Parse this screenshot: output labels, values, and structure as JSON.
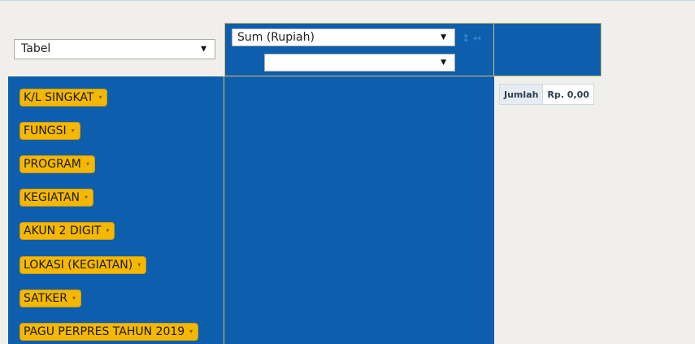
{
  "renderer": {
    "selected": "Tabel",
    "caret_icon": "triangle-down"
  },
  "aggregator": {
    "selected": "Sum (Rupiah)",
    "attribute_selected": "",
    "sort_row_icon": "↕",
    "sort_col_icon": "↔"
  },
  "row_fields": [
    "K/L SINGKAT",
    "FUNGSI",
    "PROGRAM",
    "KEGIATAN",
    "AKUN 2 DIGIT",
    "LOKASI (KEGIATAN)",
    "SATKER",
    "PAGU PERPRES TAHUN 2019"
  ],
  "pill_arrow_icon": "▾",
  "totals": {
    "label": "Jumlah",
    "value": "Rp. 0,00"
  },
  "colors": {
    "panel_blue": "#0d5ead",
    "pill_yellow": "#f5b800",
    "border_gold": "#d7bf66"
  }
}
